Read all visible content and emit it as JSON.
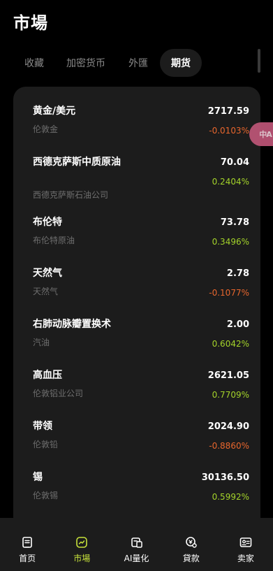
{
  "page": {
    "title": "市場"
  },
  "tabs": [
    {
      "label": "收藏"
    },
    {
      "label": "加密货币"
    },
    {
      "label": "外匯"
    },
    {
      "label": "期货"
    }
  ],
  "active_tab": "期货",
  "colors": {
    "up": "#a4d32a",
    "down": "#e8662d",
    "accent": "#c7e23b",
    "card": "#1c1c1c"
  },
  "translate_button": {
    "icon": "translate-icon",
    "text": "中A"
  },
  "items": [
    {
      "name": "黄金/美元",
      "sub": "伦敦金",
      "price": "2717.59",
      "change": "-0.0103%",
      "direction": "down"
    },
    {
      "name": "西德克萨斯中质原油",
      "sub": "西德克萨斯石油公司",
      "price": "70.04",
      "change": "0.2404%",
      "direction": "up"
    },
    {
      "name": "布伦特",
      "sub": "布伦特原油",
      "price": "73.78",
      "change": "0.3496%",
      "direction": "up"
    },
    {
      "name": "天然气",
      "sub": "天然气",
      "price": "2.78",
      "change": "-0.1077%",
      "direction": "down"
    },
    {
      "name": "右肺动脉瓣置换术",
      "sub": "汽油",
      "price": "2.00",
      "change": "0.6042%",
      "direction": "up"
    },
    {
      "name": "高血压",
      "sub": "伦敦铝业公司",
      "price": "2621.05",
      "change": "0.7709%",
      "direction": "up"
    },
    {
      "name": "带领",
      "sub": "伦敦铅",
      "price": "2024.90",
      "change": "-0.8860%",
      "direction": "down"
    },
    {
      "name": "锡",
      "sub": "伦敦锡",
      "price": "30136.50",
      "change": "0.5992%",
      "direction": "up"
    }
  ],
  "nav": [
    {
      "label": "首页",
      "icon": "home-icon"
    },
    {
      "label": "市場",
      "icon": "market-icon"
    },
    {
      "label": "AI量化",
      "icon": "ai-quant-icon"
    },
    {
      "label": "貸款",
      "icon": "loan-icon"
    },
    {
      "label": "卖家",
      "icon": "seller-icon"
    }
  ]
}
